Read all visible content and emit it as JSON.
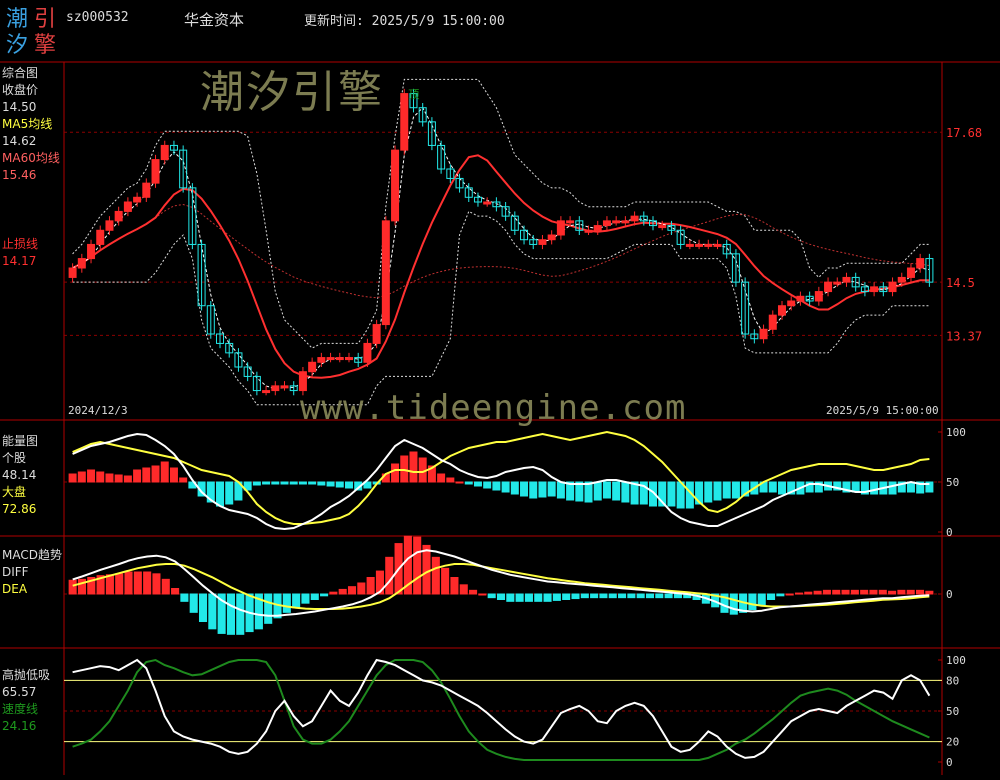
{
  "header": {
    "code": "sz000532",
    "name": "华金资本",
    "time_label": "更新时间:",
    "time": "2025/5/9 15:00:00"
  },
  "logo": {
    "chars": [
      "潮",
      "引",
      "汐",
      "擎"
    ],
    "colors": [
      "#3aa0e0",
      "#e04040",
      "#3aa0e0",
      "#e04040"
    ]
  },
  "watermark": {
    "cn": "潮汐引擎",
    "url": "www.tideengine.com"
  },
  "colors": {
    "up": "#ff2a2a",
    "down": "#22e8e8",
    "ma5": "#ffffff",
    "ma60": "#ff3030",
    "yellow": "#ffff40",
    "green": "#1e8a1e",
    "grid": "#8b0000",
    "axis": "#b00000"
  },
  "main": {
    "labels": [
      "综合图",
      "收盘价",
      "14.50",
      "MA5均线",
      "14.62",
      "MA60均线",
      "15.46",
      "止损线",
      "14.17"
    ],
    "label_colors": [
      "#ddd",
      "#ddd",
      "#ddd",
      "#ffff40",
      "#ddd",
      "#ff6060",
      "#ff6060",
      "#ff3030",
      "#ff3030"
    ],
    "price_levels": [
      17.68,
      14.5,
      13.37
    ],
    "price_colors": [
      "#ff3030",
      "#ff3030",
      "#ff3030"
    ],
    "start_date": "2024/12/3",
    "end_date": "2025/5/9 15:00:00",
    "top_marker": "顶"
  },
  "energy": {
    "labels": [
      "能量图",
      "个股",
      "48.14",
      "大盘",
      "72.86"
    ],
    "label_colors": [
      "#ddd",
      "#ddd",
      "#ddd",
      "#ffff40",
      "#ffff40"
    ],
    "ticks": [
      100,
      50,
      0
    ]
  },
  "macd": {
    "labels": [
      "MACD趋势",
      "DIFF",
      "DEA"
    ],
    "label_colors": [
      "#ddd",
      "#ddd",
      "#ffff40"
    ],
    "ticks": [
      0
    ]
  },
  "gdx": {
    "labels": [
      "高抛低吸",
      "65.57",
      "速度线",
      "24.16"
    ],
    "label_colors": [
      "#ddd",
      "#ddd",
      "#1e9a1e",
      "#1e9a1e"
    ],
    "ticks": [
      100,
      80,
      50,
      20,
      0
    ]
  },
  "chart_data": [
    {
      "type": "candlestick",
      "x": [
        "2024/12/3",
        "2025/5/9"
      ],
      "close": [
        14.8,
        15.0,
        15.3,
        15.6,
        15.8,
        16.0,
        16.2,
        16.3,
        16.6,
        17.1,
        17.4,
        17.3,
        16.5,
        15.3,
        14.0,
        13.4,
        13.2,
        13.0,
        12.7,
        12.5,
        12.2,
        12.2,
        12.3,
        12.3,
        12.2,
        12.6,
        12.8,
        12.9,
        12.9,
        12.9,
        12.9,
        12.8,
        13.2,
        13.6,
        15.8,
        17.3,
        18.5,
        18.2,
        17.9,
        17.4,
        16.9,
        16.7,
        16.5,
        16.3,
        16.2,
        16.2,
        16.1,
        15.9,
        15.6,
        15.4,
        15.3,
        15.4,
        15.5,
        15.8,
        15.8,
        15.6,
        15.6,
        15.7,
        15.8,
        15.8,
        15.8,
        15.9,
        15.8,
        15.7,
        15.7,
        15.6,
        15.3,
        15.3,
        15.3,
        15.3,
        15.3,
        15.1,
        14.5,
        13.4,
        13.3,
        13.5,
        13.8,
        14.0,
        14.1,
        14.2,
        14.1,
        14.3,
        14.5,
        14.5,
        14.6,
        14.4,
        14.3,
        14.4,
        14.3,
        14.5,
        14.6,
        14.8,
        15.0,
        14.5
      ],
      "ma5_value": 14.62,
      "ma60_value": 15.46,
      "stop_loss": 14.17
    },
    {
      "type": "line",
      "name": "能量图",
      "series": [
        {
          "name": "个股",
          "values": [
            78,
            82,
            86,
            88,
            90,
            93,
            96,
            98,
            97,
            92,
            86,
            78,
            66,
            52,
            40,
            32,
            26,
            22,
            20,
            18,
            14,
            8,
            4,
            3,
            4,
            8,
            12,
            18,
            25,
            30,
            36,
            44,
            52,
            62,
            74,
            86,
            92,
            88,
            84,
            78,
            72,
            68,
            62,
            58,
            55,
            54,
            56,
            60,
            62,
            64,
            65,
            62,
            55,
            50,
            48,
            48,
            48,
            50,
            52,
            52,
            50,
            48,
            46,
            40,
            30,
            20,
            14,
            10,
            8,
            6,
            6,
            10,
            14,
            18,
            22,
            26,
            32,
            36,
            40,
            44,
            48,
            48,
            46,
            44,
            42,
            40,
            40,
            42,
            44,
            46,
            48,
            50,
            48,
            48
          ]
        },
        {
          "name": "大盘",
          "values": [
            80,
            84,
            88,
            90,
            88,
            86,
            84,
            82,
            80,
            78,
            76,
            74,
            70,
            66,
            62,
            60,
            58,
            56,
            50,
            40,
            28,
            20,
            14,
            10,
            8,
            8,
            9,
            10,
            12,
            14,
            18,
            26,
            36,
            48,
            58,
            62,
            62,
            60,
            60,
            64,
            70,
            76,
            80,
            84,
            86,
            88,
            90,
            90,
            92,
            94,
            96,
            98,
            96,
            94,
            92,
            94,
            96,
            98,
            100,
            98,
            96,
            92,
            86,
            78,
            70,
            60,
            50,
            40,
            30,
            22,
            20,
            24,
            30,
            38,
            44,
            50,
            54,
            58,
            62,
            64,
            66,
            68,
            68,
            68,
            68,
            66,
            64,
            62,
            62,
            64,
            66,
            68,
            72,
            73
          ]
        },
        {
          "name": "bars",
          "values": [
            8,
            10,
            12,
            10,
            8,
            7,
            6,
            12,
            14,
            16,
            20,
            14,
            4,
            -6,
            -14,
            -20,
            -24,
            -22,
            -18,
            -8,
            -3,
            -2,
            -2,
            -2,
            -2,
            -2,
            -2,
            -3,
            -4,
            -5,
            -6,
            -8,
            -6,
            -2,
            8,
            18,
            26,
            30,
            24,
            16,
            8,
            4,
            0,
            -2,
            -4,
            -6,
            -8,
            -10,
            -12,
            -14,
            -16,
            -15,
            -14,
            -16,
            -18,
            -19,
            -20,
            -18,
            -16,
            -18,
            -20,
            -22,
            -22,
            -24,
            -24,
            -24,
            -26,
            -26,
            -22,
            -20,
            -18,
            -16,
            -16,
            -14,
            -12,
            -10,
            -10,
            -12,
            -12,
            -12,
            -10,
            -10,
            -8,
            -8,
            -10,
            -10,
            -12,
            -12,
            -12,
            -12,
            -10,
            -10,
            -11,
            -10
          ]
        }
      ]
    },
    {
      "type": "line",
      "name": "MACD趋势",
      "series": [
        {
          "name": "DIFF",
          "values": [
            0.35,
            0.42,
            0.5,
            0.58,
            0.65,
            0.72,
            0.8,
            0.86,
            0.9,
            0.92,
            0.88,
            0.78,
            0.6,
            0.4,
            0.2,
            0.02,
            -0.15,
            -0.28,
            -0.38,
            -0.45,
            -0.5,
            -0.52,
            -0.52,
            -0.5,
            -0.48,
            -0.45,
            -0.42,
            -0.38,
            -0.34,
            -0.3,
            -0.25,
            -0.18,
            -0.08,
            0.05,
            0.3,
            0.6,
            0.85,
            1.0,
            1.05,
            1.02,
            0.96,
            0.9,
            0.82,
            0.74,
            0.66,
            0.58,
            0.52,
            0.46,
            0.42,
            0.38,
            0.34,
            0.3,
            0.28,
            0.26,
            0.24,
            0.22,
            0.2,
            0.18,
            0.16,
            0.14,
            0.12,
            0.1,
            0.08,
            0.06,
            0.04,
            0.02,
            0.0,
            -0.04,
            -0.1,
            -0.18,
            -0.28,
            -0.36,
            -0.4,
            -0.42,
            -0.4,
            -0.36,
            -0.32,
            -0.3,
            -0.28,
            -0.26,
            -0.24,
            -0.22,
            -0.2,
            -0.18,
            -0.16,
            -0.14,
            -0.12,
            -0.1,
            -0.1,
            -0.08,
            -0.06,
            -0.04,
            -0.03
          ]
        },
        {
          "name": "DEA",
          "values": [
            0.2,
            0.26,
            0.32,
            0.38,
            0.44,
            0.5,
            0.56,
            0.62,
            0.66,
            0.7,
            0.72,
            0.72,
            0.68,
            0.6,
            0.5,
            0.4,
            0.28,
            0.16,
            0.06,
            -0.04,
            -0.12,
            -0.2,
            -0.26,
            -0.3,
            -0.33,
            -0.35,
            -0.36,
            -0.36,
            -0.36,
            -0.35,
            -0.33,
            -0.3,
            -0.26,
            -0.2,
            -0.1,
            0.05,
            0.22,
            0.38,
            0.52,
            0.62,
            0.68,
            0.72,
            0.72,
            0.7,
            0.66,
            0.62,
            0.58,
            0.54,
            0.5,
            0.46,
            0.42,
            0.38,
            0.35,
            0.32,
            0.29,
            0.26,
            0.24,
            0.22,
            0.2,
            0.18,
            0.16,
            0.14,
            0.12,
            0.1,
            0.08,
            0.06,
            0.04,
            0.02,
            0.0,
            -0.04,
            -0.08,
            -0.14,
            -0.2,
            -0.25,
            -0.28,
            -0.3,
            -0.3,
            -0.3,
            -0.29,
            -0.28,
            -0.27,
            -0.26,
            -0.24,
            -0.22,
            -0.2,
            -0.18,
            -0.16,
            -0.14,
            -0.13,
            -0.12,
            -0.1,
            -0.08,
            -0.06
          ]
        }
      ]
    },
    {
      "type": "line",
      "name": "高抛低吸",
      "series": [
        {
          "name": "高抛低吸",
          "values": [
            88,
            90,
            92,
            94,
            93,
            90,
            95,
            100,
            92,
            70,
            45,
            30,
            25,
            22,
            20,
            18,
            15,
            10,
            8,
            10,
            18,
            30,
            50,
            60,
            45,
            35,
            40,
            55,
            70,
            60,
            55,
            68,
            85,
            100,
            98,
            95,
            90,
            85,
            80,
            78,
            75,
            70,
            65,
            60,
            55,
            48,
            40,
            32,
            25,
            20,
            18,
            22,
            35,
            48,
            52,
            55,
            50,
            40,
            38,
            50,
            55,
            58,
            55,
            45,
            30,
            15,
            10,
            12,
            20,
            30,
            25,
            15,
            8,
            4,
            5,
            10,
            20,
            30,
            40,
            45,
            50,
            52,
            50,
            48,
            55,
            60,
            65,
            70,
            68,
            62,
            80,
            85,
            80,
            65
          ]
        },
        {
          "name": "速度线",
          "values": [
            15,
            18,
            22,
            30,
            40,
            55,
            70,
            88,
            98,
            100,
            95,
            92,
            88,
            85,
            86,
            90,
            94,
            98,
            100,
            100,
            100,
            98,
            85,
            60,
            35,
            22,
            18,
            18,
            22,
            30,
            40,
            55,
            70,
            85,
            95,
            100,
            100,
            100,
            98,
            90,
            78,
            62,
            45,
            30,
            20,
            12,
            8,
            5,
            3,
            2,
            2,
            2,
            2,
            2,
            2,
            2,
            2,
            2,
            2,
            2,
            2,
            2,
            2,
            2,
            2,
            2,
            2,
            2,
            2,
            4,
            8,
            12,
            18,
            22,
            28,
            35,
            42,
            50,
            58,
            65,
            68,
            70,
            72,
            70,
            66,
            60,
            55,
            50,
            45,
            40,
            36,
            32,
            28,
            24
          ]
        }
      ]
    }
  ]
}
